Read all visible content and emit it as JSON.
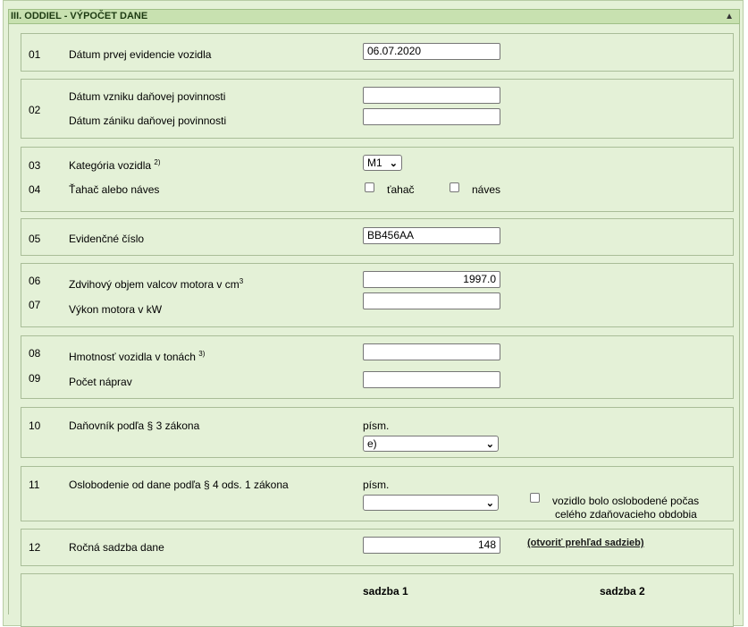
{
  "section_title": "III. ODDIEL - VÝPOČET DANE",
  "collapse_icon": "chevron-up-icon",
  "rows": {
    "r01": {
      "num": "01",
      "label": "Dátum prvej evidencie vozidla",
      "value": "06.07.2020"
    },
    "r02": {
      "num": "02",
      "label_a": "Dátum vzniku daňovej povinnosti",
      "value_a": "",
      "label_b": "Dátum zániku daňovej povinnosti",
      "value_b": ""
    },
    "r03": {
      "num": "03",
      "label": "Kategória vozidla",
      "sup": "2)",
      "select": "M1"
    },
    "r04": {
      "num": "04",
      "label": "Ťahač alebo náves",
      "opt1": "ťahač",
      "opt2": "náves"
    },
    "r05": {
      "num": "05",
      "label": "Evidenčné číslo",
      "value": "BB456AA"
    },
    "r06": {
      "num": "06",
      "label": "Zdvihový objem valcov motora v cm",
      "sup": "3",
      "value": "1997.0"
    },
    "r07": {
      "num": "07",
      "label": "Výkon motora v kW",
      "value": ""
    },
    "r08": {
      "num": "08",
      "label": "Hmotnosť vozidla v tonách",
      "sup": "3)",
      "value": ""
    },
    "r09": {
      "num": "09",
      "label": "Počet náprav",
      "value": ""
    },
    "r10": {
      "num": "10",
      "label": "Daňovník podľa § 3 zákona",
      "sub": "písm.",
      "select": "e)"
    },
    "r11": {
      "num": "11",
      "label": "Oslobodenie od dane podľa § 4 ods. 1 zákona",
      "sub": "písm.",
      "select": "",
      "check_line1": "vozidlo bolo oslobodené počas",
      "check_line2": "celého zdaňovacieho obdobia"
    },
    "r12": {
      "num": "12",
      "label": "Ročná sadzba dane",
      "value": "148",
      "link": "(otvoriť prehľad sadzieb)"
    },
    "r13": {
      "col1": "sadzba 1",
      "col2": "sadzba 2"
    }
  }
}
